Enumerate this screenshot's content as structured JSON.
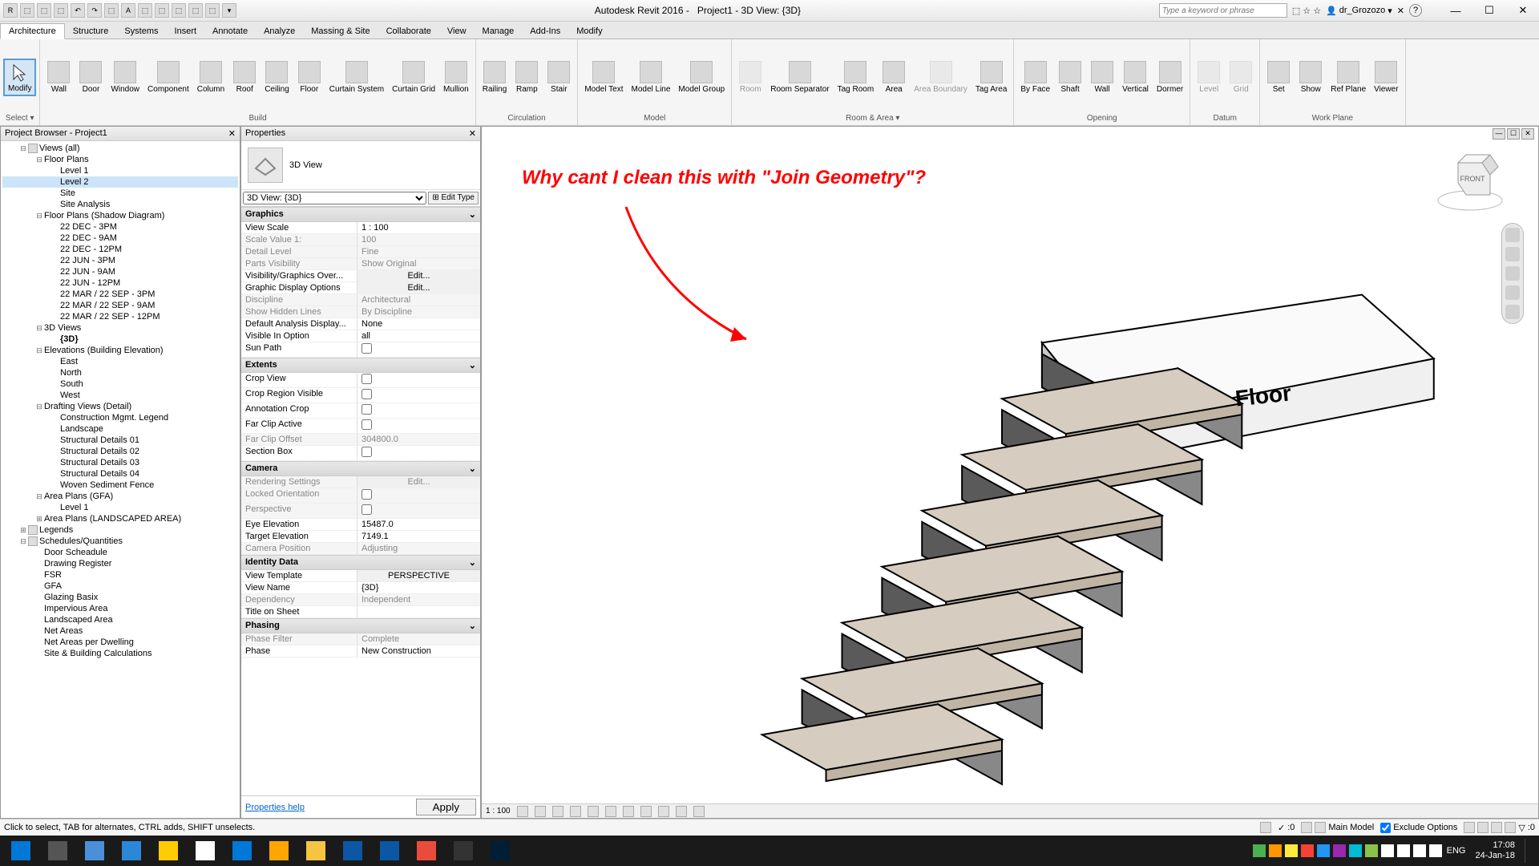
{
  "app_title": "Autodesk Revit 2016 -",
  "doc_title": "Project1 - 3D View: {3D}",
  "search_placeholder": "Type a keyword or phrase",
  "user_name": "dr_Grozozo",
  "qat_items": [
    "R",
    "⬚",
    "⬚",
    "⬚",
    "↶",
    "↷",
    "⬚",
    "A",
    "⬚",
    "⬚",
    "⬚",
    "⬚",
    "⬚",
    "▾"
  ],
  "tabs": [
    "Architecture",
    "Structure",
    "Systems",
    "Insert",
    "Annotate",
    "Analyze",
    "Massing & Site",
    "Collaborate",
    "View",
    "Manage",
    "Add-Ins",
    "Modify"
  ],
  "active_tab": "Architecture",
  "ribbon": {
    "select": {
      "label": "Select ▾",
      "btn": "Modify"
    },
    "groups": [
      {
        "name": "Build",
        "buttons": [
          "Wall",
          "Door",
          "Window",
          "Component",
          "Column",
          "Roof",
          "Ceiling",
          "Floor",
          "Curtain System",
          "Curtain Grid",
          "Mullion"
        ]
      },
      {
        "name": "Circulation",
        "buttons": [
          "Railing",
          "Ramp",
          "Stair"
        ]
      },
      {
        "name": "Model",
        "buttons": [
          "Model Text",
          "Model Line",
          "Model Group"
        ]
      },
      {
        "name": "Room & Area ▾",
        "buttons": [
          "Room",
          "Room Separator",
          "Tag Room",
          "Area",
          "Area Boundary",
          "Tag Area"
        ]
      },
      {
        "name": "Opening",
        "buttons": [
          "By Face",
          "Shaft",
          "Wall",
          "Vertical",
          "Dormer"
        ]
      },
      {
        "name": "Datum",
        "buttons": [
          "Level",
          "Grid"
        ]
      },
      {
        "name": "Work Plane",
        "buttons": [
          "Set",
          "Show",
          "Ref Plane",
          "Viewer"
        ]
      }
    ],
    "disabled": [
      "Room",
      "Area Boundary",
      "Level",
      "Grid"
    ]
  },
  "browser": {
    "title": "Project Browser - Project1",
    "tree": [
      {
        "l": 0,
        "t": "Views (all)",
        "exp": true,
        "icon": true
      },
      {
        "l": 1,
        "t": "Floor Plans",
        "exp": true
      },
      {
        "l": 2,
        "t": "Level 1"
      },
      {
        "l": 2,
        "t": "Level 2",
        "sel": true
      },
      {
        "l": 2,
        "t": "Site"
      },
      {
        "l": 2,
        "t": "Site Analysis"
      },
      {
        "l": 1,
        "t": "Floor Plans (Shadow Diagram)",
        "exp": true
      },
      {
        "l": 2,
        "t": "22 DEC - 3PM"
      },
      {
        "l": 2,
        "t": "22 DEC - 9AM"
      },
      {
        "l": 2,
        "t": "22 DEC - 12PM"
      },
      {
        "l": 2,
        "t": "22 JUN - 3PM"
      },
      {
        "l": 2,
        "t": "22 JUN - 9AM"
      },
      {
        "l": 2,
        "t": "22 JUN - 12PM"
      },
      {
        "l": 2,
        "t": "22 MAR / 22 SEP - 3PM"
      },
      {
        "l": 2,
        "t": "22 MAR / 22 SEP - 9AM"
      },
      {
        "l": 2,
        "t": "22 MAR / 22 SEP - 12PM"
      },
      {
        "l": 1,
        "t": "3D Views",
        "exp": true
      },
      {
        "l": 2,
        "t": "{3D}",
        "bold": true
      },
      {
        "l": 1,
        "t": "Elevations (Building Elevation)",
        "exp": true
      },
      {
        "l": 2,
        "t": "East"
      },
      {
        "l": 2,
        "t": "North"
      },
      {
        "l": 2,
        "t": "South"
      },
      {
        "l": 2,
        "t": "West"
      },
      {
        "l": 1,
        "t": "Drafting Views (Detail)",
        "exp": true
      },
      {
        "l": 2,
        "t": "Construction Mgmt. Legend"
      },
      {
        "l": 2,
        "t": "Landscape"
      },
      {
        "l": 2,
        "t": "Structural Details 01"
      },
      {
        "l": 2,
        "t": "Structural Details 02"
      },
      {
        "l": 2,
        "t": "Structural Details 03"
      },
      {
        "l": 2,
        "t": "Structural Details 04"
      },
      {
        "l": 2,
        "t": "Woven Sediment Fence"
      },
      {
        "l": 1,
        "t": "Area Plans (GFA)",
        "exp": true
      },
      {
        "l": 2,
        "t": "Level 1"
      },
      {
        "l": 1,
        "t": "Area Plans (LANDSCAPED AREA)",
        "exp": false
      },
      {
        "l": 0,
        "t": "Legends",
        "exp": false,
        "icon": true
      },
      {
        "l": 0,
        "t": "Schedules/Quantities",
        "exp": true,
        "icon": true
      },
      {
        "l": 1,
        "t": "Door Scheadule"
      },
      {
        "l": 1,
        "t": "Drawing Register"
      },
      {
        "l": 1,
        "t": "FSR"
      },
      {
        "l": 1,
        "t": "GFA"
      },
      {
        "l": 1,
        "t": "Glazing Basix"
      },
      {
        "l": 1,
        "t": "Impervious Area"
      },
      {
        "l": 1,
        "t": "Landscaped Area"
      },
      {
        "l": 1,
        "t": "Net Areas"
      },
      {
        "l": 1,
        "t": "Net Areas per Dwelling"
      },
      {
        "l": 1,
        "t": "Site & Building Calculations"
      }
    ]
  },
  "props": {
    "title": "Properties",
    "type_name": "3D View",
    "selector": "3D View: {3D}",
    "edit_type": "Edit Type",
    "groups": [
      {
        "name": "Graphics",
        "rows": [
          {
            "k": "View Scale",
            "v": "1 : 100",
            "type": "select"
          },
          {
            "k": "Scale Value    1:",
            "v": "100",
            "d": true
          },
          {
            "k": "Detail Level",
            "v": "Fine",
            "d": true
          },
          {
            "k": "Parts Visibility",
            "v": "Show Original",
            "d": true
          },
          {
            "k": "Visibility/Graphics Over...",
            "v": "Edit...",
            "type": "btn"
          },
          {
            "k": "Graphic Display Options",
            "v": "Edit...",
            "type": "btn"
          },
          {
            "k": "Discipline",
            "v": "Architectural",
            "d": true
          },
          {
            "k": "Show Hidden Lines",
            "v": "By Discipline",
            "d": true
          },
          {
            "k": "Default Analysis Display...",
            "v": "None"
          },
          {
            "k": "Visible In Option",
            "v": "all"
          },
          {
            "k": "Sun Path",
            "v": "",
            "type": "check"
          }
        ]
      },
      {
        "name": "Extents",
        "rows": [
          {
            "k": "Crop View",
            "v": "",
            "type": "check"
          },
          {
            "k": "Crop Region Visible",
            "v": "",
            "type": "check"
          },
          {
            "k": "Annotation Crop",
            "v": "",
            "type": "check"
          },
          {
            "k": "Far Clip Active",
            "v": "",
            "type": "check"
          },
          {
            "k": "Far Clip Offset",
            "v": "304800.0",
            "d": true
          },
          {
            "k": "Section Box",
            "v": "",
            "type": "check"
          }
        ]
      },
      {
        "name": "Camera",
        "rows": [
          {
            "k": "Rendering Settings",
            "v": "Edit...",
            "type": "btn",
            "d": true
          },
          {
            "k": "Locked Orientation",
            "v": "",
            "type": "check",
            "d": true
          },
          {
            "k": "Perspective",
            "v": "",
            "type": "check",
            "d": true
          },
          {
            "k": "Eye Elevation",
            "v": "15487.0"
          },
          {
            "k": "Target Elevation",
            "v": "7149.1"
          },
          {
            "k": "Camera Position",
            "v": "Adjusting",
            "d": true
          }
        ]
      },
      {
        "name": "Identity Data",
        "rows": [
          {
            "k": "View Template",
            "v": "PERSPECTIVE",
            "type": "btn"
          },
          {
            "k": "View Name",
            "v": "{3D}"
          },
          {
            "k": "Dependency",
            "v": "Independent",
            "d": true
          },
          {
            "k": "Title on Sheet",
            "v": ""
          }
        ]
      },
      {
        "name": "Phasing",
        "rows": [
          {
            "k": "Phase Filter",
            "v": "Complete",
            "d": true
          },
          {
            "k": "Phase",
            "v": "New Construction"
          }
        ]
      }
    ],
    "help_link": "Properties help",
    "apply": "Apply"
  },
  "viewport": {
    "scale": "1 : 100",
    "annotation": "Why cant I clean this with \"Join Geometry\"?",
    "floor_label": "Floor",
    "cube_face": "FRONT"
  },
  "status": {
    "hint": "Click to select, TAB for alternates, CTRL adds, SHIFT unselects.",
    "sel_count": ":0",
    "model": "Main Model",
    "exclude": "Exclude Options",
    "filter": ":0"
  },
  "task_icons": [
    "⊞",
    "◯",
    "▭",
    "◧",
    "◨",
    "◩",
    "◪",
    "◫",
    "◬",
    "◭",
    "◮",
    "◯",
    "◰",
    "◱"
  ],
  "tray_icons": [
    "S",
    "⬥",
    "⬥",
    "⬥",
    "⬥",
    "⬥",
    "⬥",
    "⬥",
    "⬥",
    "⬥",
    "⬥",
    "⬥"
  ],
  "lang": "ENG",
  "time": "17:08",
  "date": "24-Jan-18"
}
